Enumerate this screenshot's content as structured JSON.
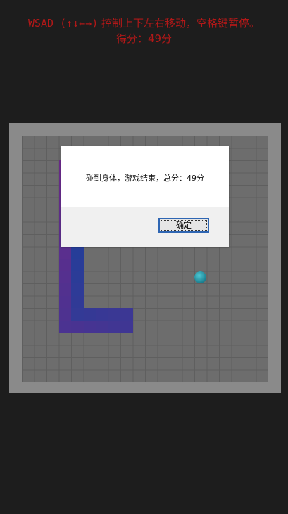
{
  "header": {
    "keys_text": "WSAD (↑↓←→)",
    "instructions_text": " 控制上下左右移动，空格键暂停。",
    "score_label": "得分：",
    "score": "49分"
  },
  "colors": {
    "background": "#1d1d1d",
    "header_text": "#b11818",
    "board_frame": "#8a8a8a",
    "board": "#6d6d6d",
    "snake_start": "#6b2a8a",
    "snake_end": "#1f3f9a",
    "food": "#2aa3b3"
  },
  "game": {
    "grid": {
      "cols": 20,
      "rows": 20
    },
    "snake": [
      [
        3,
        2
      ],
      [
        3,
        3
      ],
      [
        3,
        4
      ],
      [
        3,
        5
      ],
      [
        3,
        6
      ],
      [
        3,
        7
      ],
      [
        3,
        8
      ],
      [
        3,
        9
      ],
      [
        3,
        10
      ],
      [
        3,
        11
      ],
      [
        3,
        12
      ],
      [
        3,
        13
      ],
      [
        3,
        14
      ],
      [
        3,
        15
      ],
      [
        4,
        15
      ],
      [
        5,
        15
      ],
      [
        6,
        15
      ],
      [
        7,
        15
      ],
      [
        8,
        15
      ],
      [
        8,
        14
      ],
      [
        7,
        14
      ],
      [
        6,
        14
      ],
      [
        5,
        14
      ],
      [
        4,
        14
      ],
      [
        4,
        13
      ],
      [
        4,
        12
      ],
      [
        4,
        11
      ],
      [
        4,
        10
      ],
      [
        4,
        9
      ],
      [
        4,
        8
      ],
      [
        4,
        7
      ],
      [
        4,
        6
      ]
    ],
    "food": [
      14,
      11
    ]
  },
  "dialog": {
    "message": "碰到身体，游戏结束，总分：49分",
    "ok_label": "确定"
  }
}
